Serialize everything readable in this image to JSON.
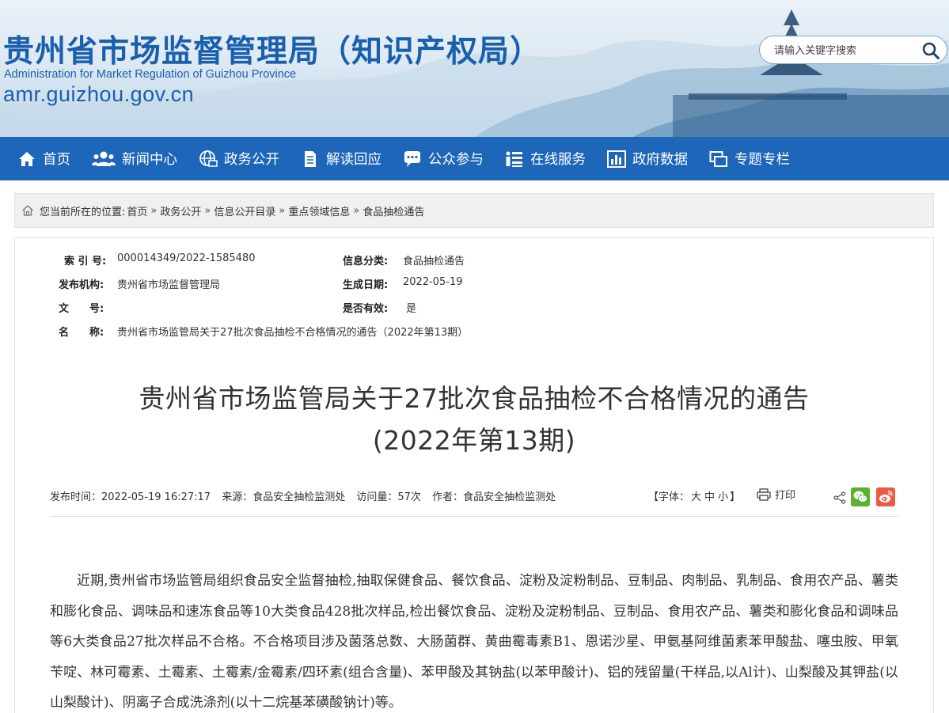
{
  "header": {
    "title_cn": "贵州省市场监督管理局（知识产权局）",
    "title_en": "Administration for Market Regulation of Guizhou Province",
    "url": "amr.guizhou.gov.cn",
    "search": {
      "placeholder": "请输入关键字搜索",
      "icon": "search-icon"
    },
    "colors": {
      "brand_blue": "#1a5fae",
      "nav_blue": "#1e66b9"
    }
  },
  "nav": {
    "items": [
      {
        "label": "首页",
        "icon": "home-icon"
      },
      {
        "label": "新闻中心",
        "icon": "people-icon"
      },
      {
        "label": "政务公开",
        "icon": "globe-icon"
      },
      {
        "label": "解读回应",
        "icon": "document-icon"
      },
      {
        "label": "公众参与",
        "icon": "chat-icon"
      },
      {
        "label": "在线服务",
        "icon": "list-icon"
      },
      {
        "label": "政府数据",
        "icon": "bar-chart-icon"
      },
      {
        "label": "专题专栏",
        "icon": "window-icon"
      }
    ]
  },
  "breadcrumb": {
    "prefix": "您当前所在的位置:",
    "items": [
      "首页",
      "政务公开",
      "信息公开目录",
      "重点领域信息",
      "食品抽检通告"
    ],
    "separator": "»"
  },
  "meta": {
    "index_label": "索 引 号:",
    "index_value": "000014349/2022-1585480",
    "category_label": "信息分类:",
    "category_value": "食品抽检通告",
    "publisher_label": "发布机构:",
    "publisher_value": "贵州省市场监督管理局",
    "date_label": "生成日期:",
    "date_value": "2022-05-19",
    "docno_label": "文　　号:",
    "docno_value": "",
    "valid_label": "是否有效:",
    "valid_value": "是",
    "name_label": "名　　称:",
    "name_value": "贵州省市场监管局关于27批次食品抽检不合格情况的通告（2022年第13期）"
  },
  "article": {
    "title_line1": "贵州省市场监管局关于27批次食品抽检不合格情况的通告",
    "title_line2": "(2022年第13期)",
    "publish_time": "发布时间：2022-05-19 16:27:17",
    "source": "来源：食品安全抽检监测处",
    "views": "访问量：57次",
    "author": "作者：食品安全抽检监测处",
    "font_label_open": "【字体：",
    "font_large": "大",
    "font_medium": "中",
    "font_small": "小",
    "font_label_close": "】",
    "print_label": "打印",
    "body": "近期,贵州省市场监管局组织食品安全监督抽检,抽取保健食品、餐饮食品、淀粉及淀粉制品、豆制品、肉制品、乳制品、食用农产品、薯类和膨化食品、调味品和速冻食品等10大类食品428批次样品,检出餐饮食品、淀粉及淀粉制品、豆制品、食用农产品、薯类和膨化食品和调味品等6大类食品27批次样品不合格。不合格项目涉及菌落总数、大肠菌群、黄曲霉毒素B1、恩诺沙星、甲氨基阿维菌素苯甲酸盐、噻虫胺、甲氧苄啶、林可霉素、土霉素、土霉素/金霉素/四环素(组合含量)、苯甲酸及其钠盐(以苯甲酸计)、铝的残留量(干样品,以Al计)、山梨酸及其钾盐(以山梨酸计)、阴离子合成洗涤剂(以十二烷基苯磺酸钠计)等。"
  }
}
